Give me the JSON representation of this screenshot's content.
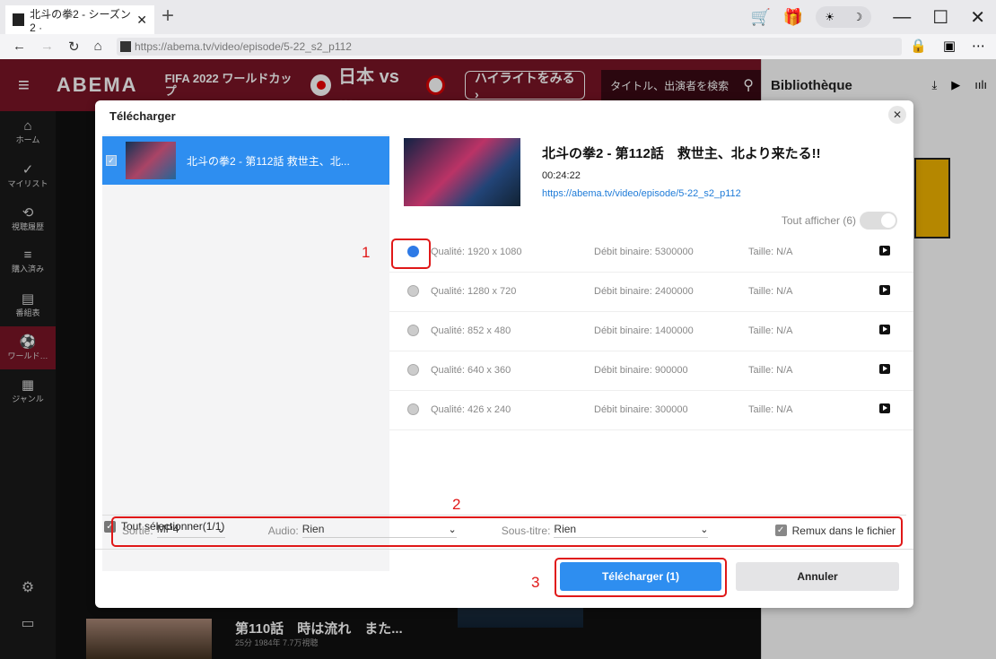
{
  "browser": {
    "tab_title": "北斗の拳2 - シーズン2 ·",
    "tab_close": "✕",
    "new_tab": "+",
    "url": "https://abema.tv/video/episode/5-22_s2_p112",
    "theme_icons": [
      "☀",
      "☽"
    ],
    "window_controls": [
      "—",
      "☐",
      "✕"
    ],
    "nav_icons": [
      "←",
      "→",
      "↻",
      "⌂"
    ],
    "addr_icons": [
      "🔒",
      "▣",
      "⋯"
    ]
  },
  "abema": {
    "logo": "ABEMA",
    "fifa": "FIFA 2022 ワールドカップ",
    "match_title": "日本 vs ...",
    "highlight_btn": "ハイライトをみる ›",
    "search_placeholder": "タイトル、出演者を検索",
    "sidebar": [
      {
        "icon": "⌂",
        "label": "ホーム"
      },
      {
        "icon": "✓",
        "label": "マイリスト"
      },
      {
        "icon": "⟲",
        "label": "視聴履歴"
      },
      {
        "icon": "≡",
        "label": "購入済み"
      },
      {
        "icon": "▤",
        "label": "番組表"
      },
      {
        "icon": "⚽",
        "label": "ワールド…"
      },
      {
        "icon": "▦",
        "label": "ジャンル"
      }
    ],
    "bottom_ep_title": "第110話　時は流れ　また...",
    "bottom_ep_meta": "25分 1984年 7.7万視聴"
  },
  "library": {
    "title": "Bibliothèque"
  },
  "modal": {
    "title": "Télécharger",
    "close": "✕",
    "list_item": "北斗の拳2 - 第112話  救世主、北...",
    "select_all": "Tout sélectionner(1/1)",
    "detail": {
      "title": "北斗の拳2 - 第112話　救世主、北より来たる!!",
      "duration": "00:24:22",
      "url": "https://abema.tv/video/episode/5-22_s2_p112",
      "show_all": "Tout afficher (6)"
    },
    "qualities": [
      {
        "quality": "Qualité: 1920 x 1080",
        "rate": "Débit binaire: 5300000",
        "size": "Taille: N/A",
        "selected": true
      },
      {
        "quality": "Qualité: 1280 x 720",
        "rate": "Débit binaire: 2400000",
        "size": "Taille: N/A",
        "selected": false
      },
      {
        "quality": "Qualité: 852 x 480",
        "rate": "Débit binaire: 1400000",
        "size": "Taille: N/A",
        "selected": false
      },
      {
        "quality": "Qualité: 640 x 360",
        "rate": "Débit binaire: 900000",
        "size": "Taille: N/A",
        "selected": false
      },
      {
        "quality": "Qualité: 426 x 240",
        "rate": "Débit binaire: 300000",
        "size": "Taille: N/A",
        "selected": false
      }
    ],
    "options": {
      "output_label": "Sortie:",
      "output_value": "MP4",
      "audio_label": "Audio:",
      "audio_value": "Rien",
      "subtitle_label": "Sous-titre:",
      "subtitle_value": "Rien",
      "remux_label": "Remux dans le fichier"
    },
    "download_btn": "Télécharger (1)",
    "cancel_btn": "Annuler"
  },
  "annotations": [
    "1",
    "2",
    "3"
  ],
  "colors": {
    "accent": "#2e8ef0",
    "annotation": "#e01818",
    "abema_header": "#7a1526"
  }
}
